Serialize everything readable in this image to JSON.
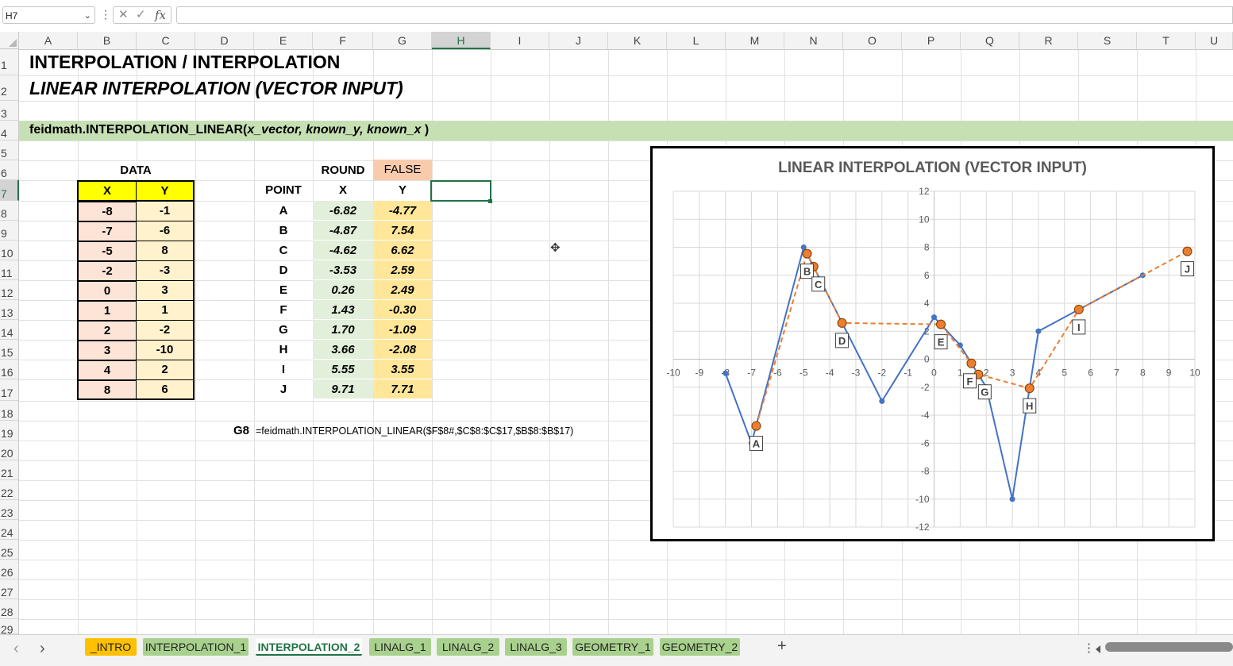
{
  "formula_bar": {
    "name_box": "H7",
    "fx": "fx",
    "cancel": "✕",
    "enter": "✓",
    "content": ""
  },
  "columns": [
    "A",
    "B",
    "C",
    "D",
    "E",
    "F",
    "G",
    "H",
    "I",
    "J",
    "K",
    "L",
    "M",
    "N",
    "O",
    "P",
    "Q",
    "R",
    "S",
    "T",
    "U"
  ],
  "selected_column": "H",
  "rows": [
    "1",
    "2",
    "3",
    "4",
    "5",
    "6",
    "7",
    "8",
    "9",
    "10",
    "11",
    "12",
    "13",
    "14",
    "15",
    "16",
    "17",
    "18",
    "19",
    "20",
    "21",
    "22",
    "23",
    "24",
    "25",
    "26",
    "27",
    "28",
    "29"
  ],
  "selected_row": "7",
  "sheet": {
    "title1": "INTERPOLATION / INTERPOLATION",
    "title2": "LINEAR INTERPOLATION (VECTOR INPUT)",
    "syntax_func": "feidmath.INTERPOLATION_LINEAR(",
    "syntax_args": "x_vector, known_y, known_x",
    "syntax_close": " )",
    "data_header": "DATA",
    "data_x_header": "X",
    "data_y_header": "Y",
    "data": [
      {
        "x": "-8",
        "y": "-1"
      },
      {
        "x": "-7",
        "y": "-6"
      },
      {
        "x": "-5",
        "y": "8"
      },
      {
        "x": "-2",
        "y": "-3"
      },
      {
        "x": "0",
        "y": "3"
      },
      {
        "x": "1",
        "y": "1"
      },
      {
        "x": "2",
        "y": "-2"
      },
      {
        "x": "3",
        "y": "-10"
      },
      {
        "x": "4",
        "y": "2"
      },
      {
        "x": "8",
        "y": "6"
      }
    ],
    "round_label": "ROUND",
    "round_value": "FALSE",
    "point_header": "POINT",
    "point_x_header": "X",
    "point_y_header": "Y",
    "points": [
      {
        "p": "A",
        "x": "-6.82",
        "y": "-4.77"
      },
      {
        "p": "B",
        "x": "-4.87",
        "y": "7.54"
      },
      {
        "p": "C",
        "x": "-4.62",
        "y": "6.62"
      },
      {
        "p": "D",
        "x": "-3.53",
        "y": "2.59"
      },
      {
        "p": "E",
        "x": "0.26",
        "y": "2.49"
      },
      {
        "p": "F",
        "x": "1.43",
        "y": "-0.30"
      },
      {
        "p": "G",
        "x": "1.70",
        "y": "-1.09"
      },
      {
        "p": "H",
        "x": "3.66",
        "y": "-2.08"
      },
      {
        "p": "I",
        "x": "5.55",
        "y": "3.55"
      },
      {
        "p": "J",
        "x": "9.71",
        "y": "7.71"
      }
    ],
    "formula_cell": "G8",
    "formula_text": "=feidmath.INTERPOLATION_LINEAR($F$8#,$C$8:$C$17,$B$8:$B$17)"
  },
  "chart_data": {
    "type": "scatter",
    "title": "LINEAR INTERPOLATION (VECTOR INPUT)",
    "xlim": [
      -10,
      10
    ],
    "ylim": [
      -12,
      12
    ],
    "x_ticks": [
      "-10",
      "-9",
      "-8",
      "-7",
      "-6",
      "-5",
      "-4",
      "-3",
      "-2",
      "-1",
      "0",
      "1",
      "2",
      "3",
      "4",
      "5",
      "6",
      "7",
      "8",
      "9",
      "10"
    ],
    "y_ticks": [
      "12",
      "10",
      "8",
      "6",
      "4",
      "2",
      "0",
      "-2",
      "-4",
      "-6",
      "-8",
      "-10",
      "-12"
    ],
    "grid": true,
    "series": [
      {
        "x": [
          -8,
          -7,
          -5,
          -2,
          0,
          1,
          2,
          3,
          4,
          8
        ],
        "y": [
          -1,
          -6,
          8,
          -3,
          3,
          1,
          -2,
          -10,
          2,
          6
        ],
        "color": "#4472c4",
        "style": "solid"
      },
      {
        "x": [
          -6.82,
          -4.87,
          -4.62,
          -3.53,
          0.26,
          1.43,
          1.7,
          3.66,
          5.55,
          9.71
        ],
        "y": [
          -4.77,
          7.54,
          6.62,
          2.59,
          2.49,
          -0.3,
          -1.09,
          -2.08,
          3.55,
          7.71
        ],
        "labels": [
          "A",
          "B",
          "C",
          "D",
          "E",
          "F",
          "G",
          "H",
          "I",
          "J"
        ],
        "color": "#ed7d31",
        "style": "dashed"
      }
    ]
  },
  "tabs": [
    {
      "label": "_INTRO",
      "color": "#ffc000",
      "active": false
    },
    {
      "label": "INTERPOLATION_1",
      "color": "#a9d18e",
      "active": false
    },
    {
      "label": "INTERPOLATION_2",
      "color": "#ffffff",
      "active": true
    },
    {
      "label": "LINALG_1",
      "color": "#a9d18e",
      "active": false
    },
    {
      "label": "LINALG_2",
      "color": "#a9d18e",
      "active": false
    },
    {
      "label": "LINALG_3",
      "color": "#a9d18e",
      "active": false
    },
    {
      "label": "GEOMETRY_1",
      "color": "#a9d18e",
      "active": false
    },
    {
      "label": "GEOMETRY_2",
      "color": "#a9d18e",
      "active": false
    }
  ],
  "add_sheet": "+",
  "nav_prev": "‹",
  "nav_next": "›",
  "menu_dots": "⋮"
}
